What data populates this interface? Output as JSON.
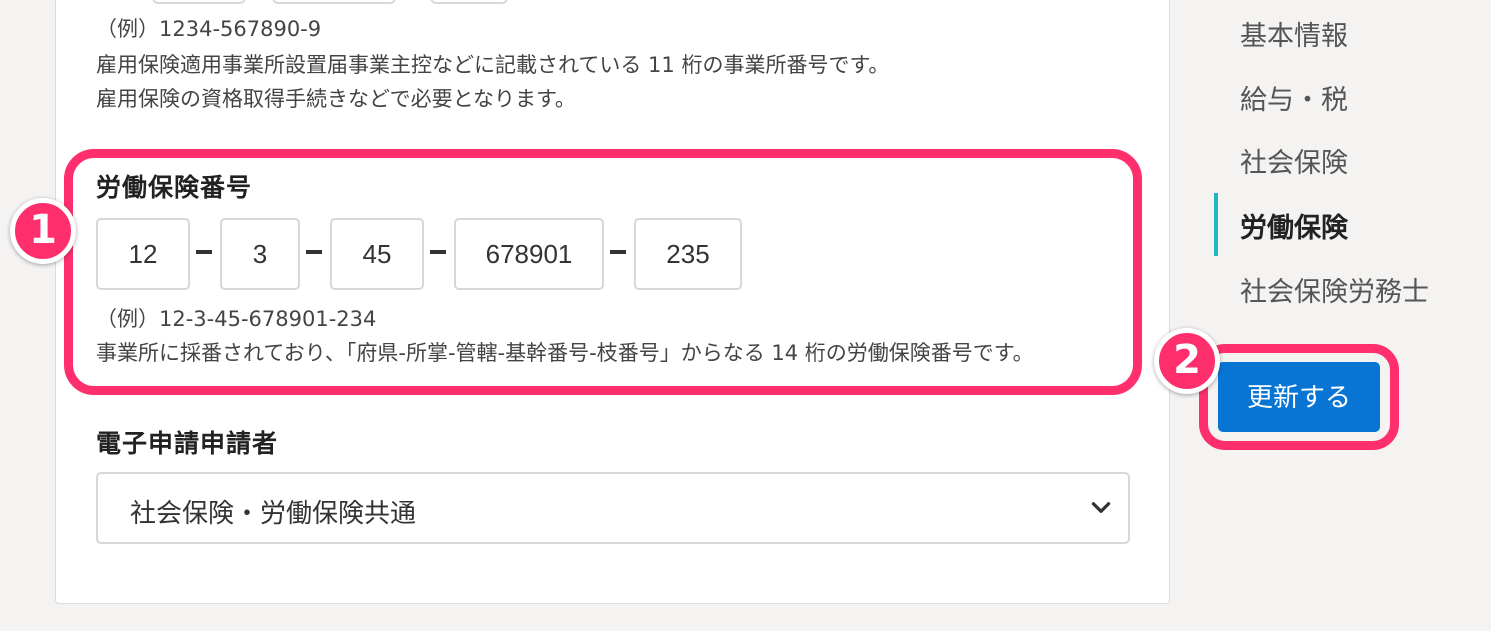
{
  "employment_insurance": {
    "example": "（例）1234-567890-9",
    "description_line1": "雇用保険適用事業所設置届事業主控などに記載されている 11 桁の事業所番号です。",
    "description_line2": "雇用保険の資格取得手続きなどで必要となります。"
  },
  "labor_insurance": {
    "title": "労働保険番号",
    "fields": [
      "12",
      "3",
      "45",
      "678901",
      "235"
    ],
    "example": "（例）12-3-45-678901-234",
    "description": "事業所に採番されており、「府県-所掌-管轄-基幹番号-枝番号」からなる 14 桁の労働保険番号です。"
  },
  "electronic_applicant": {
    "title": "電子申請申請者",
    "selected": "社会保険・労働保険共通"
  },
  "sidebar": {
    "items": [
      {
        "label": "基本情報"
      },
      {
        "label": "給与・税"
      },
      {
        "label": "社会保険"
      },
      {
        "label": "労働保険"
      },
      {
        "label": "社会保険労務士"
      }
    ],
    "active_index": 3
  },
  "update_button": {
    "label": "更新する"
  },
  "annotations": {
    "badge1": "1",
    "badge2": "2"
  },
  "colors": {
    "accent": "#ff2f6e",
    "button": "#0875d4",
    "nav_indicator": "#1fb8c7"
  }
}
